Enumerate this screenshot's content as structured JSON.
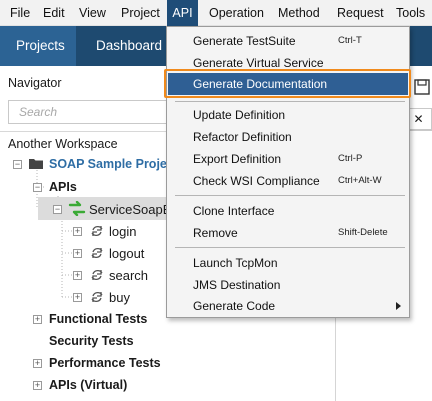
{
  "menubar": {
    "items": [
      "File",
      "Edit",
      "View",
      "Project",
      "API",
      "Operation",
      "Method",
      "Request",
      "Tools"
    ],
    "active_item": "API"
  },
  "topbar": {
    "tabs": [
      "Projects",
      "Dashboard"
    ],
    "selected_tab": "Projects"
  },
  "navigator": {
    "title": "Navigator",
    "search_placeholder": "Search",
    "workspace": "Another Workspace",
    "project": "SOAP Sample Proje",
    "apis_label": "APIs",
    "service": "ServiceSoapB",
    "operations": [
      "login",
      "logout",
      "search",
      "buy"
    ],
    "sections": [
      "Functional Tests",
      "Security Tests",
      "Performance Tests",
      "APIs (Virtual)"
    ]
  },
  "right_panel": {
    "tab_close": "✕"
  },
  "api_menu": {
    "items": [
      {
        "label": "Generate TestSuite",
        "shortcut": "Ctrl-T"
      },
      {
        "label": "Generate Virtual Service",
        "shortcut": ""
      },
      {
        "label": "Generate Documentation",
        "shortcut": "",
        "highlighted": true
      },
      {
        "label": "Update Definition",
        "shortcut": ""
      },
      {
        "label": "Refactor Definition",
        "shortcut": ""
      },
      {
        "label": "Export Definition",
        "shortcut": "Ctrl-P"
      },
      {
        "label": "Check WSI Compliance",
        "shortcut": "Ctrl+Alt-W"
      },
      {
        "label": "Clone Interface",
        "shortcut": ""
      },
      {
        "label": "Remove",
        "shortcut": "Shift-Delete"
      },
      {
        "label": "Launch TcpMon",
        "shortcut": ""
      },
      {
        "label": "JMS Destination",
        "shortcut": ""
      },
      {
        "label": "Generate Code",
        "shortcut": "",
        "submenu": true
      }
    ]
  },
  "colors": {
    "menu_active": "#1f4d78",
    "topbar": "#1e4a70",
    "highlight": "#2f5f94",
    "outline": "#f08a1c",
    "project_link": "#2e6da4",
    "service_icon": "#3aaa35"
  }
}
